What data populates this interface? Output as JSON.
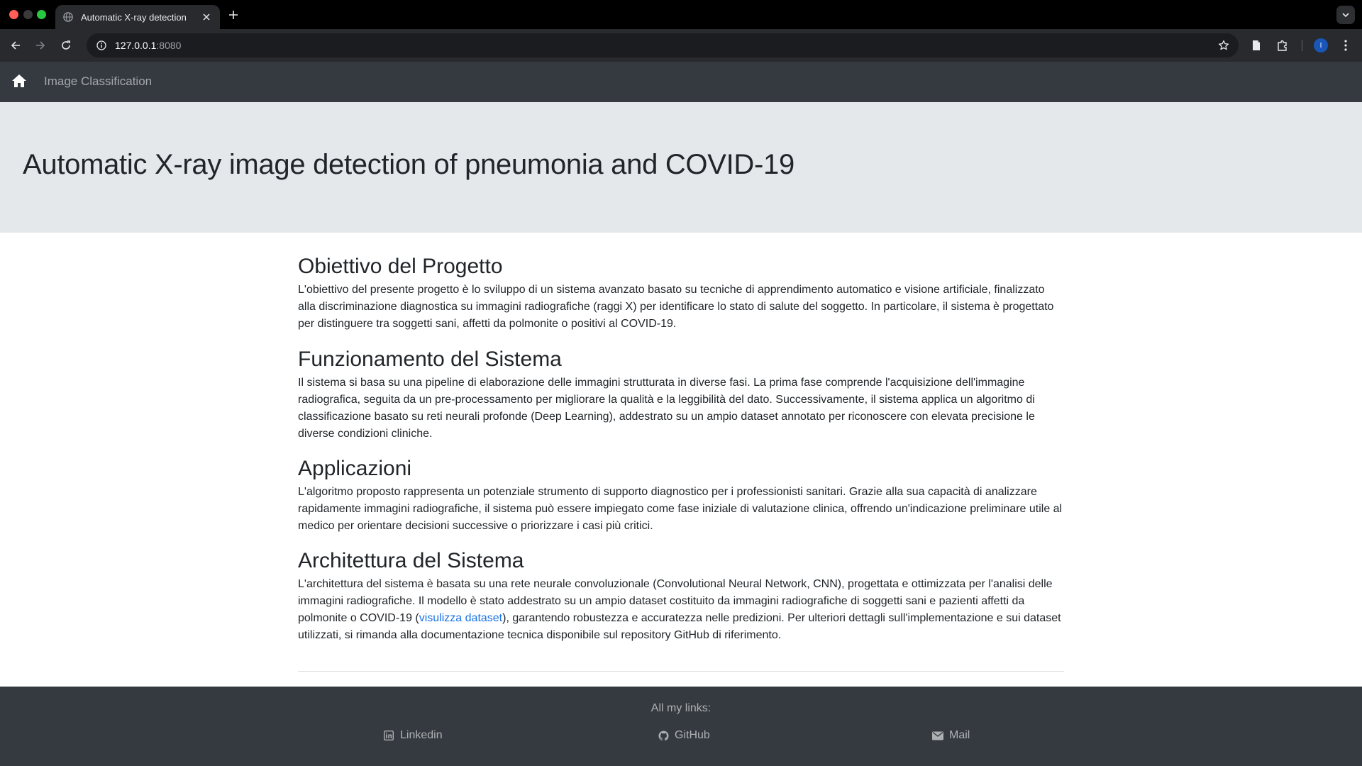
{
  "browser": {
    "tab_title": "Automatic X-ray detection",
    "url_host": "127.0.0.1",
    "url_port": ":8080",
    "profile_initial": "I"
  },
  "navbar": {
    "brand": "Image Classification"
  },
  "jumbotron": {
    "title": "Automatic X-ray image detection of pneumonia and COVID-19"
  },
  "sections": [
    {
      "title": "Obiettivo del Progetto",
      "text": "L'obiettivo del presente progetto è lo sviluppo di un sistema avanzato basato su tecniche di apprendimento automatico e visione artificiale, finalizzato alla discriminazione diagnostica su immagini radiografiche (raggi X) per identificare lo stato di salute del soggetto. In particolare, il sistema è progettato per distinguere tra soggetti sani, affetti da polmonite o positivi al COVID-19."
    },
    {
      "title": "Funzionamento del Sistema",
      "text": "Il sistema si basa su una pipeline di elaborazione delle immagini strutturata in diverse fasi. La prima fase comprende l'acquisizione dell'immagine radiografica, seguita da un pre-processamento per migliorare la qualità e la leggibilità del dato. Successivamente, il sistema applica un algoritmo di classificazione basato su reti neurali profonde (Deep Learning), addestrato su un ampio dataset annotato per riconoscere con elevata precisione le diverse condizioni cliniche."
    },
    {
      "title": "Applicazioni",
      "text": "L'algoritmo proposto rappresenta un potenziale strumento di supporto diagnostico per i professionisti sanitari. Grazie alla sua capacità di analizzare rapidamente immagini radiografiche, il sistema può essere impiegato come fase iniziale di valutazione clinica, offrendo un'indicazione preliminare utile al medico per orientare decisioni successive o priorizzare i casi più critici."
    },
    {
      "title": "Architettura del Sistema",
      "text_before": "L'architettura del sistema è basata su una rete neurale convoluzionale (Convolutional Neural Network, CNN), progettata e ottimizzata per l'analisi delle immagini radiografiche. Il modello è stato addestrato su un ampio dataset costituito da immagini radiografiche di soggetti sani e pazienti affetti da polmonite o COVID-19 (",
      "link_text": "visulizza dataset",
      "text_after": "), garantendo robustezza e accuratezza nelle predizioni. Per ulteriori dettagli sull'implementazione e sui dataset utilizzati, si rimanda alla documentazione tecnica disponibile sul repository GitHub di riferimento."
    }
  ],
  "footer": {
    "caption": "All my links:",
    "links": [
      {
        "label": "Linkedin",
        "icon": "linkedin-icon"
      },
      {
        "label": "GitHub",
        "icon": "github-icon"
      },
      {
        "label": "Mail",
        "icon": "mail-icon"
      }
    ]
  },
  "colors": {
    "navbar_bg": "#343a40",
    "jumbotron_bg": "#e5e8eb",
    "link": "#1a73e8"
  }
}
